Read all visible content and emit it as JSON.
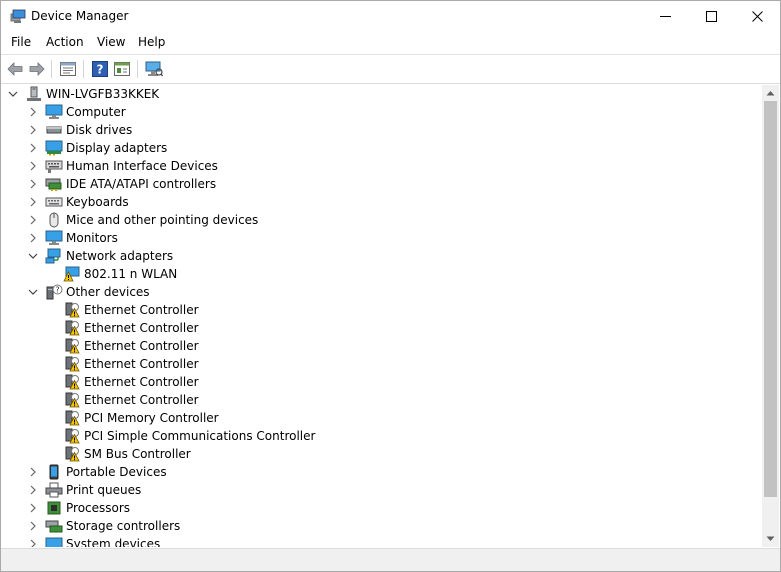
{
  "window": {
    "title": "Device Manager",
    "controls": {
      "minimize": "minimize-icon",
      "maximize": "maximize-icon",
      "close": "close-icon"
    }
  },
  "menu": [
    {
      "label": "File"
    },
    {
      "label": "Action"
    },
    {
      "label": "View"
    },
    {
      "label": "Help"
    }
  ],
  "toolbar": {
    "buttons": [
      {
        "icon": "back-arrow-icon"
      },
      {
        "icon": "forward-arrow-icon"
      },
      {
        "icon": "properties-icon"
      },
      {
        "icon": "help-icon"
      },
      {
        "icon": "show-hidden-icon"
      },
      {
        "icon": "scan-hardware-icon"
      }
    ]
  },
  "tree": {
    "root": {
      "label": "WIN-LVGFB33KKEK",
      "expanded": true
    },
    "categories": [
      {
        "label": "Computer",
        "expanded": false
      },
      {
        "label": "Disk drives",
        "expanded": false
      },
      {
        "label": "Display adapters",
        "expanded": false
      },
      {
        "label": "Human Interface Devices",
        "expanded": false
      },
      {
        "label": "IDE ATA/ATAPI controllers",
        "expanded": false
      },
      {
        "label": "Keyboards",
        "expanded": false
      },
      {
        "label": "Mice and other pointing devices",
        "expanded": false
      },
      {
        "label": "Monitors",
        "expanded": false
      },
      {
        "label": "Network adapters",
        "expanded": true,
        "children": [
          {
            "label": "802.11 n WLAN",
            "warning": true
          }
        ]
      },
      {
        "label": "Other devices",
        "expanded": true,
        "children": [
          {
            "label": "Ethernet Controller",
            "warning": true
          },
          {
            "label": "Ethernet Controller",
            "warning": true
          },
          {
            "label": "Ethernet Controller",
            "warning": true
          },
          {
            "label": "Ethernet Controller",
            "warning": true
          },
          {
            "label": "Ethernet Controller",
            "warning": true
          },
          {
            "label": "Ethernet Controller",
            "warning": true
          },
          {
            "label": "PCI Memory Controller",
            "warning": true
          },
          {
            "label": "PCI Simple Communications Controller",
            "warning": true
          },
          {
            "label": "SM Bus Controller",
            "warning": true
          }
        ]
      },
      {
        "label": "Portable Devices",
        "expanded": false
      },
      {
        "label": "Print queues",
        "expanded": false
      },
      {
        "label": "Processors",
        "expanded": false
      },
      {
        "label": "Storage controllers",
        "expanded": false
      },
      {
        "label": "System devices",
        "expanded": false
      }
    ]
  },
  "colors": {
    "warning": "#f5c400",
    "monitor": "#2f8fd8",
    "selection": "#cce8ff"
  }
}
